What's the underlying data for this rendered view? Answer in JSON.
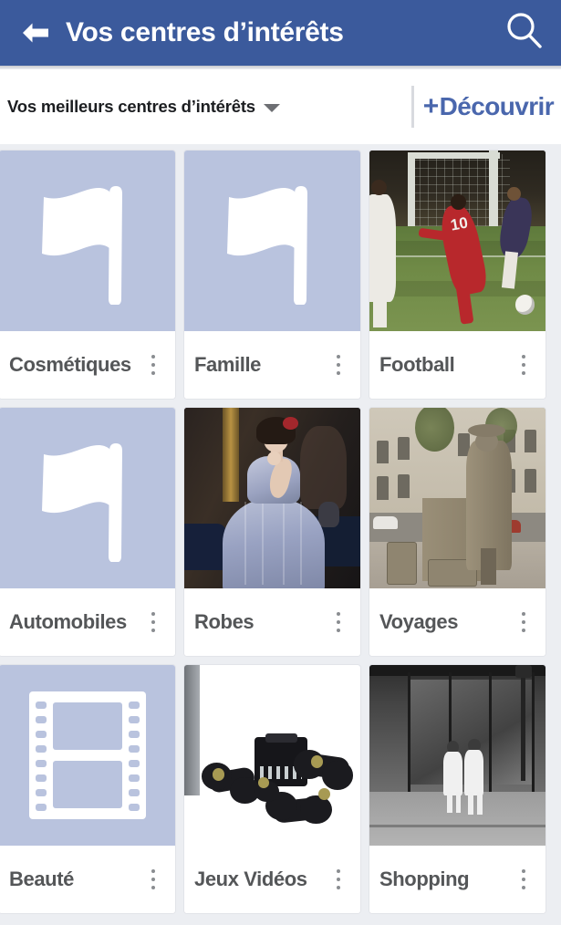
{
  "appbar": {
    "back_icon": "arrow-left-icon",
    "title": "Vos centres d’intérêts",
    "search_icon": "search-icon"
  },
  "subbar": {
    "filter_label": "Vos meilleurs centres d’intérêts",
    "caret_icon": "chevron-down-icon",
    "discover_plus": "+",
    "discover_label": "Découvrir"
  },
  "colors": {
    "appbar_blue": "#3b5a9c",
    "discover_blue": "#4a67ad",
    "placeholder_bg": "#b9c3de",
    "page_bg": "#eceef2",
    "card_title": "#545658"
  },
  "grid": {
    "menu_icon": "kebab-menu-icon",
    "cards": [
      {
        "title": "Cosmétiques",
        "thumb": "flag-placeholder-icon"
      },
      {
        "title": "Famille",
        "thumb": "flag-placeholder-icon"
      },
      {
        "title": "Football",
        "thumb": "football-photo"
      },
      {
        "title": "Automobiles",
        "thumb": "flag-placeholder-icon"
      },
      {
        "title": "Robes",
        "thumb": "portrait-painting-photo"
      },
      {
        "title": "Voyages",
        "thumb": "bronze-statue-photo"
      },
      {
        "title": "Beauté",
        "thumb": "film-strip-placeholder-icon"
      },
      {
        "title": "Jeux Vidéos",
        "thumb": "game-console-photo"
      },
      {
        "title": "Shopping",
        "thumb": "storefront-photo"
      }
    ]
  }
}
